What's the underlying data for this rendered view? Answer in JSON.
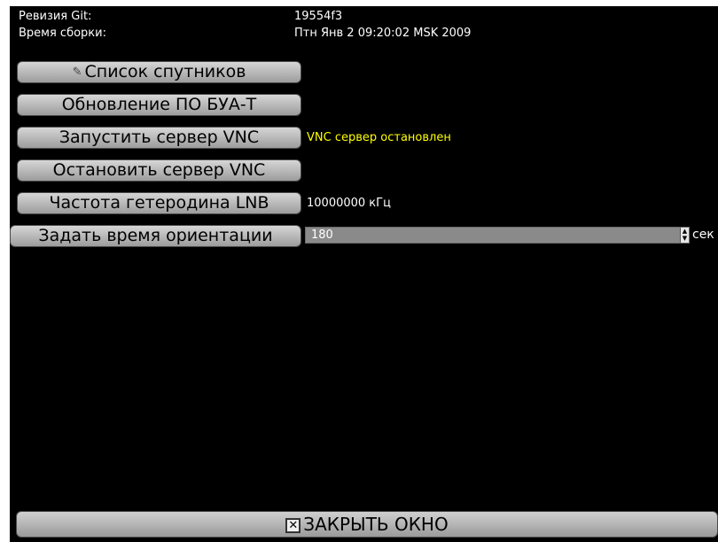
{
  "info": {
    "git_revision_label": "Ревизия Git:",
    "git_revision_value": "19554f3",
    "build_time_label": "Время сборки:",
    "build_time_value": "Птн Янв  2 09:20:02 MSK 2009"
  },
  "buttons": {
    "satellite_list": "Список спутников",
    "update_firmware": "Обновление ПО БУА-Т",
    "start_vnc": "Запустить сервер VNC",
    "stop_vnc": "Остановить сервер VNC",
    "lnb_frequency": "Частота гетеродина LNB",
    "orientation_time": "Задать время ориентации",
    "close_window": "ЗАКРЫТЬ ОКНО"
  },
  "status": {
    "vnc": "VNC сервер остановлен",
    "vnc_color": "#ffff00",
    "lnb_frequency": "10000000 кГц"
  },
  "orientation": {
    "value": "180",
    "unit": "сек"
  },
  "icons": {
    "satellite_list": "edit-icon",
    "close_window": "close-box-icon"
  }
}
